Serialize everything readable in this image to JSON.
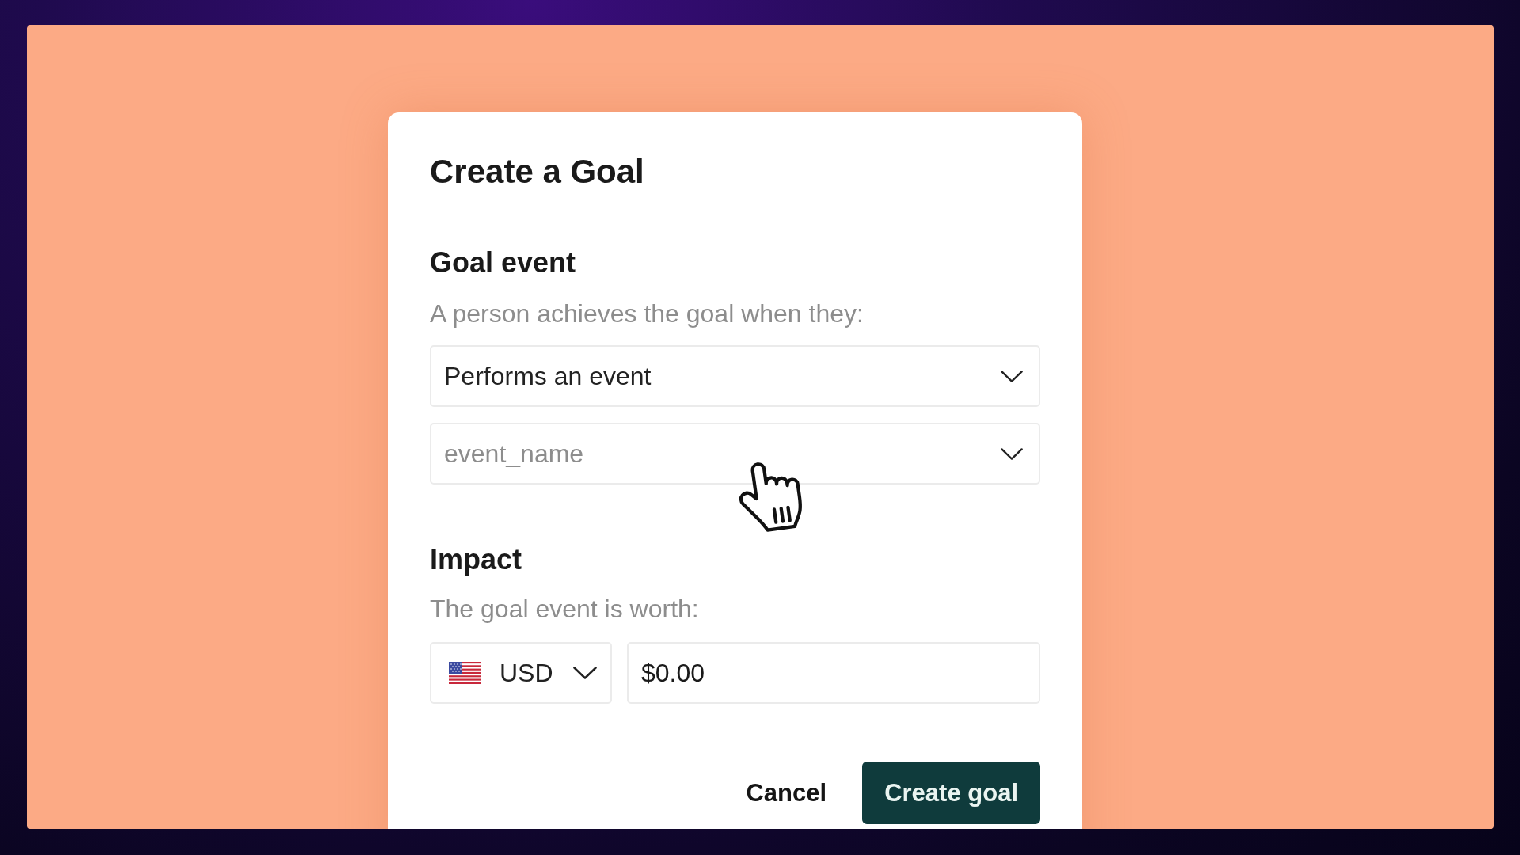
{
  "dialog": {
    "title": "Create a Goal"
  },
  "goal_event": {
    "heading": "Goal event",
    "description": "A person achieves the goal when they:",
    "condition_select": {
      "value": "Performs an event"
    },
    "event_select": {
      "placeholder": "event_name"
    }
  },
  "impact": {
    "heading": "Impact",
    "description": "The goal event is worth:",
    "currency_select": {
      "value": "USD"
    },
    "amount_field": {
      "value": "$0.00"
    }
  },
  "buttons": [
    {
      "label": "Cancel",
      "kind": "secondary"
    },
    {
      "label": "Create goal",
      "kind": "primary"
    }
  ]
}
